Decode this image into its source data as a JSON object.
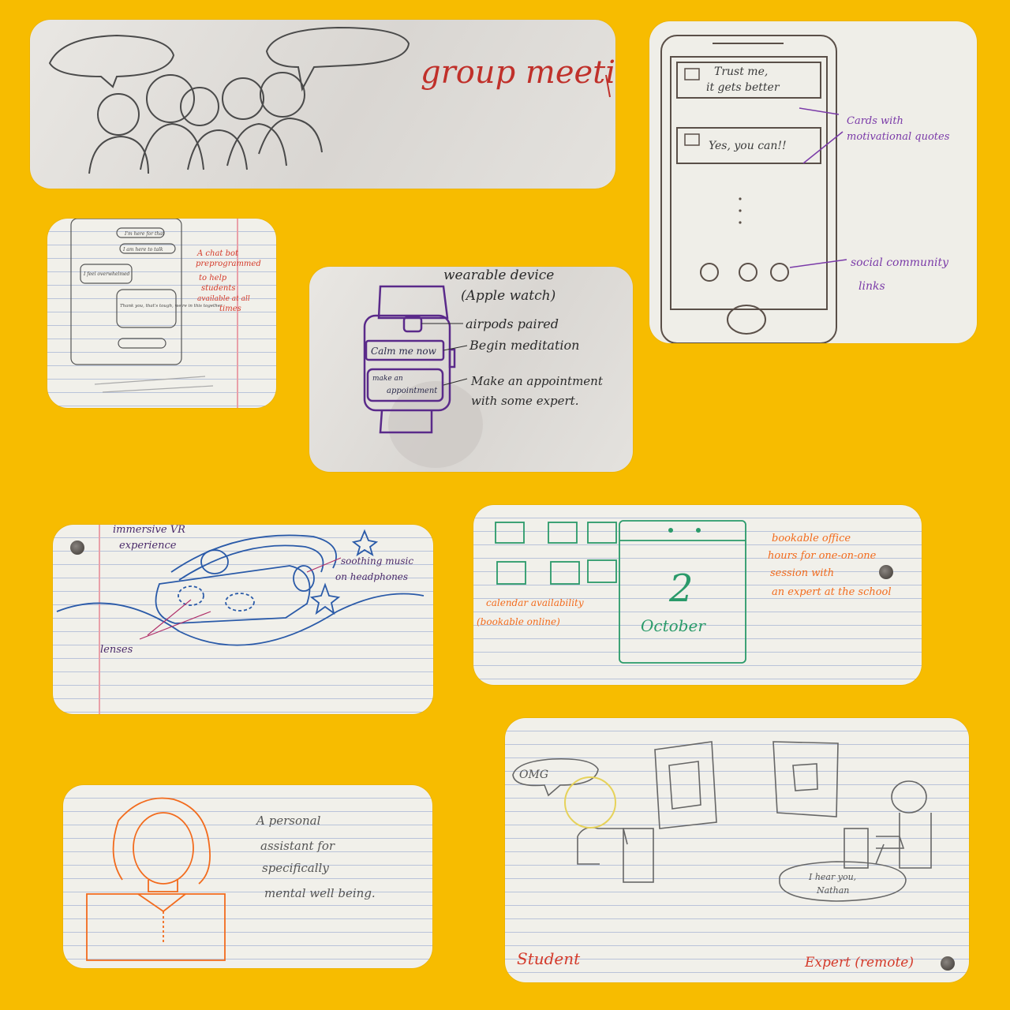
{
  "colors": {
    "background": "#f7bc00",
    "pencil": "#4a4a4a",
    "red_ink": "#d43a2a",
    "purple_ink": "#7a3aa8",
    "dark_purple_ink": "#4a2a6a",
    "blue_ink": "#2a5aa8",
    "green_ink": "#2a9a6a",
    "orange_ink": "#f26b1d"
  },
  "sketches": {
    "group_meeting": {
      "title": "group meeti"
    },
    "chatbot": {
      "bubbles": [
        "I'm here for that",
        "I am here to talk",
        "I feel overwhelmed",
        "Thank you, that's tough, we're in this together"
      ],
      "note": [
        "A chat bot",
        "preprogrammed",
        "to help",
        "students",
        "available at all",
        "times"
      ]
    },
    "motivational_app": {
      "card_1": [
        "Trust me,",
        "it gets better"
      ],
      "card_2": "Yes, you can!!",
      "note_cards": [
        "Cards with",
        "motivational quotes"
      ],
      "note_links": [
        "social community",
        "links"
      ]
    },
    "wearable": {
      "title": [
        "wearable device",
        "(Apple watch)"
      ],
      "watch_icon": "airpods",
      "button_1": "Calm me now",
      "button_2": [
        "make an",
        "appointment"
      ],
      "labels": [
        "airpods paired",
        "Begin meditation",
        "Make an appointment",
        "with some expert."
      ]
    },
    "vr": {
      "title": [
        "immersive VR",
        "experience"
      ],
      "note_music": [
        "soothing music",
        "on headphones"
      ],
      "note_lenses": "lenses"
    },
    "calendar": {
      "day": "2",
      "month": "October",
      "note_availability": [
        "calendar availability",
        "(bookable online)"
      ],
      "note_hours": [
        "bookable office",
        "hours for one-on-one",
        "session with",
        "an expert at the school"
      ]
    },
    "assistant": {
      "note": [
        "A personal",
        "assistant for",
        "specifically",
        "mental well being."
      ]
    },
    "remote_expert": {
      "student_bubble": "OMG",
      "expert_bubble": [
        "I hear you,",
        "Nathan"
      ],
      "label_student": "Student",
      "label_expert": "Expert (remote)"
    }
  }
}
